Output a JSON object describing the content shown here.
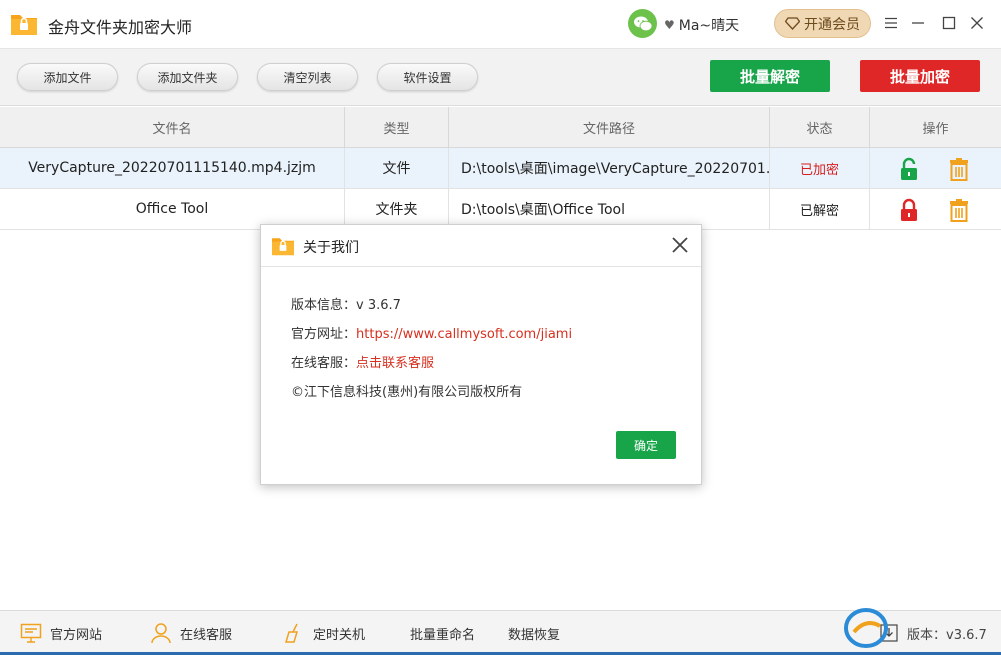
{
  "app": {
    "title": "金舟文件夹加密大师",
    "user_name": "Ma~晴天",
    "vip_label": "开通会员"
  },
  "toolbar": {
    "add_file": "添加文件",
    "add_folder": "添加文件夹",
    "clear_list": "清空列表",
    "settings": "软件设置",
    "batch_decrypt": "批量解密",
    "batch_encrypt": "批量加密"
  },
  "table": {
    "headers": [
      "文件名",
      "类型",
      "文件路径",
      "状态",
      "操作"
    ],
    "rows": [
      {
        "name": "VeryCapture_20220701115140.mp4.jzjm",
        "type": "文件",
        "path": "D:\\tools\\桌面\\image\\VeryCapture_20220701...",
        "status": "已加密",
        "lock_state": "unlocked"
      },
      {
        "name": "Office Tool",
        "type": "文件夹",
        "path": "D:\\tools\\桌面\\Office Tool",
        "status": "已解密",
        "lock_state": "locked"
      }
    ]
  },
  "dialog": {
    "title": "关于我们",
    "version_label": "版本信息：",
    "version_value": "v 3.6.7",
    "site_label": "官方网址：",
    "site_value": "https://www.callmysoft.com/jiami",
    "service_label": "在线客服：",
    "service_value": "点击联系客服",
    "copyright": "©江下信息科技(惠州)有限公司版权所有",
    "ok": "确定"
  },
  "footer": {
    "website": "官方网站",
    "support": "在线客服",
    "shutdown": "定时关机",
    "rename": "批量重命名",
    "recovery": "数据恢复",
    "version": "版本：v3.6.7"
  },
  "colors": {
    "green": "#18a54a",
    "red": "#e02727",
    "orange": "#f0a11e",
    "link_red": "#d6301f"
  }
}
